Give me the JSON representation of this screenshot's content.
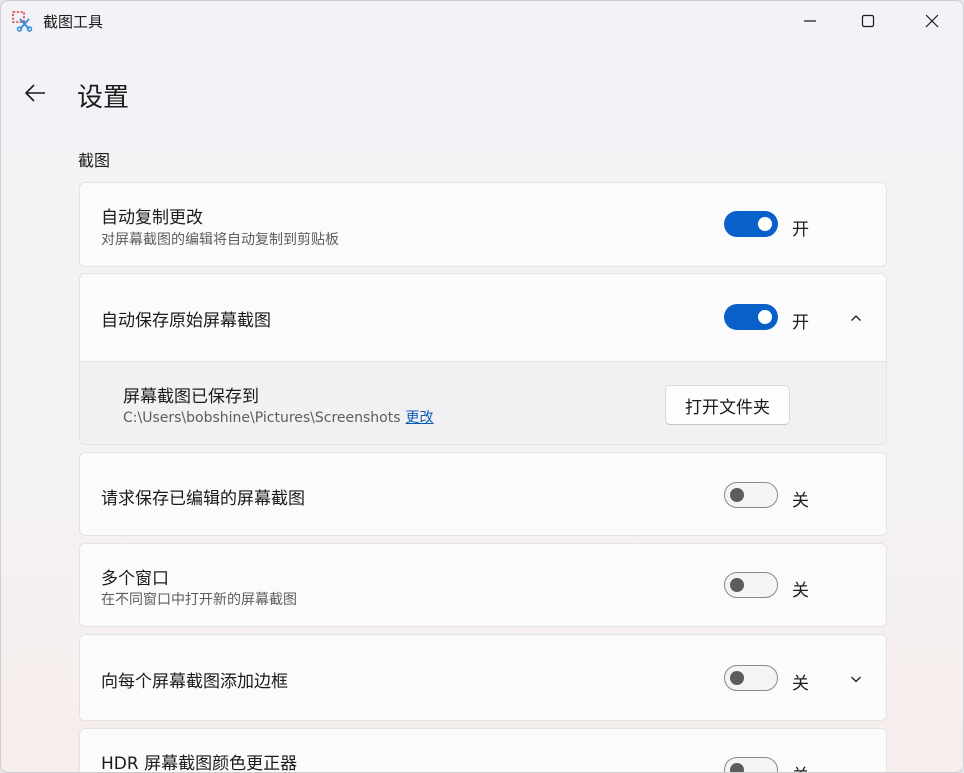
{
  "window": {
    "title": "截图工具",
    "buttons": {
      "minimize": "minimize-icon",
      "maximize": "maximize-icon",
      "close": "close-icon"
    }
  },
  "header": {
    "back_icon": "arrow-left-icon",
    "title": "设置"
  },
  "section": {
    "title": "截图"
  },
  "settings": [
    {
      "title": "自动复制更改",
      "description": "对屏幕截图的编辑将自动复制到剪贴板",
      "toggle_on": true,
      "state_label": "开"
    },
    {
      "title": "自动保存原始屏幕截图",
      "toggle_on": true,
      "state_label": "开",
      "expanded": true,
      "sub": {
        "title": "屏幕截图已保存到",
        "path": "C:\\Users\\bobshine\\Pictures\\Screenshots",
        "link": "更改",
        "button": "打开文件夹"
      }
    },
    {
      "title": "请求保存已编辑的屏幕截图",
      "toggle_on": false,
      "state_label": "关"
    },
    {
      "title": "多个窗口",
      "description": "在不同窗口中打开新的屏幕截图",
      "toggle_on": false,
      "state_label": "关"
    },
    {
      "title": "向每个屏幕截图添加边框",
      "toggle_on": false,
      "state_label": "关",
      "expanded": false
    },
    {
      "title": "HDR 屏幕截图颜色更正器",
      "toggle_on": false,
      "state_label": "关"
    }
  ],
  "colors": {
    "accent": "#0a60c9",
    "link": "#0d5bb5"
  }
}
